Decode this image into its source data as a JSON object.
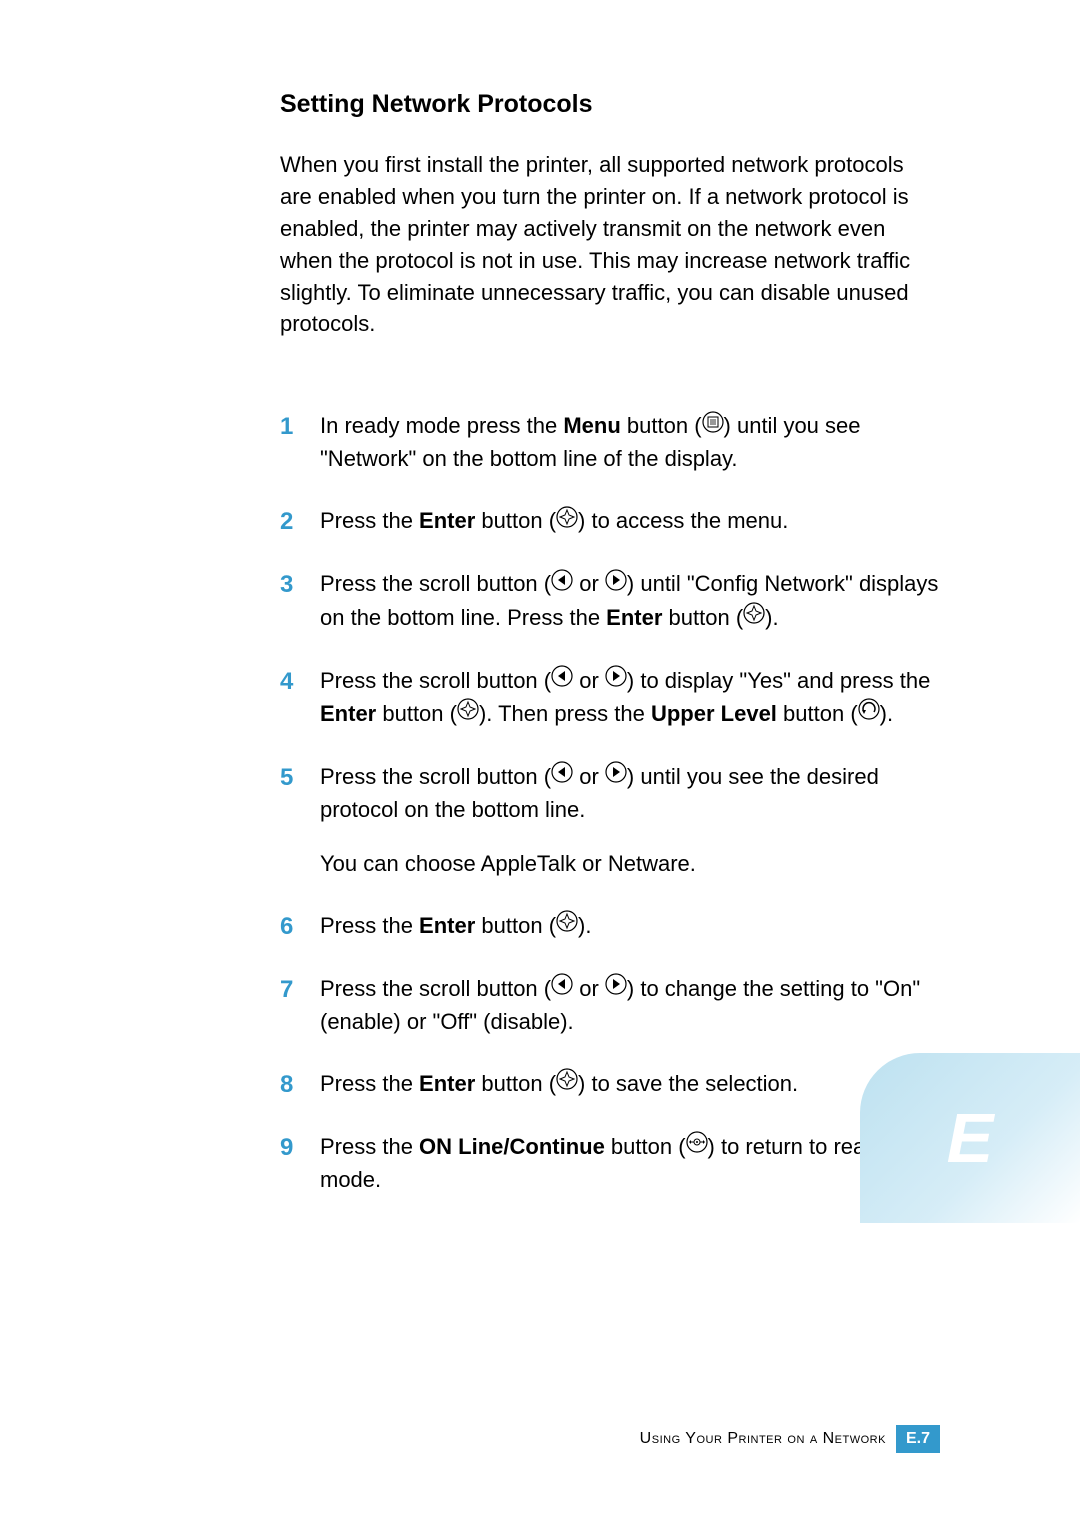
{
  "heading": "Setting Network Protocols",
  "intro": "When you first install the printer, all supported network protocols are enabled when you turn the printer on. If a network protocol is enabled, the printer may actively transmit on the network even when the protocol is not in use. This may increase network traffic slightly. To eliminate unnecessary traffic, you can disable unused protocols.",
  "steps": {
    "s1a": "In ready mode press the ",
    "s1b": "Menu",
    "s1c": " button (",
    "s1d": ") until you see \"Network\" on the bottom line of the display.",
    "s2a": "Press the ",
    "s2b": "Enter",
    "s2c": " button (",
    "s2d": ") to access the menu.",
    "s3a": "Press the scroll button (",
    "s3b": " or ",
    "s3c": ") until \"Config Network\" displays on the bottom line. Press the ",
    "s3d": "Enter",
    "s3e": " button (",
    "s3f": ").",
    "s4a": "Press the scroll button (",
    "s4b": " or ",
    "s4c": ") to display \"Yes\" and press the ",
    "s4d": "Enter",
    "s4e": " button (",
    "s4f": "). Then press the ",
    "s4g": "Upper Level",
    "s4h": " button (",
    "s4i": ").",
    "s5a": "Press the scroll button (",
    "s5b": " or ",
    "s5c": ") until you see the desired protocol on the bottom line.",
    "s5sub": "You can choose AppleTalk or Netware.",
    "s6a": "Press the ",
    "s6b": "Enter",
    "s6c": " button (",
    "s6d": ").",
    "s7a": "Press the scroll button (",
    "s7b": " or ",
    "s7c": ") to change the setting to \"On\" (enable) or \"Off\" (disable).",
    "s8a": "Press the ",
    "s8b": "Enter",
    "s8c": " button (",
    "s8d": ") to save the selection.",
    "s9a": "Press the ",
    "s9b": "ON Line/Continue",
    "s9c": " button (",
    "s9d": ") to return to ready mode."
  },
  "footer": {
    "text": "Using Your Printer on a Network",
    "page_letter": "E.",
    "page_num": "7"
  },
  "side_tab": "E",
  "icons": {
    "menu": "menu-icon",
    "enter": "enter-icon",
    "left": "left-arrow-icon",
    "right": "right-arrow-icon",
    "upper": "upper-level-icon",
    "online": "online-icon"
  }
}
